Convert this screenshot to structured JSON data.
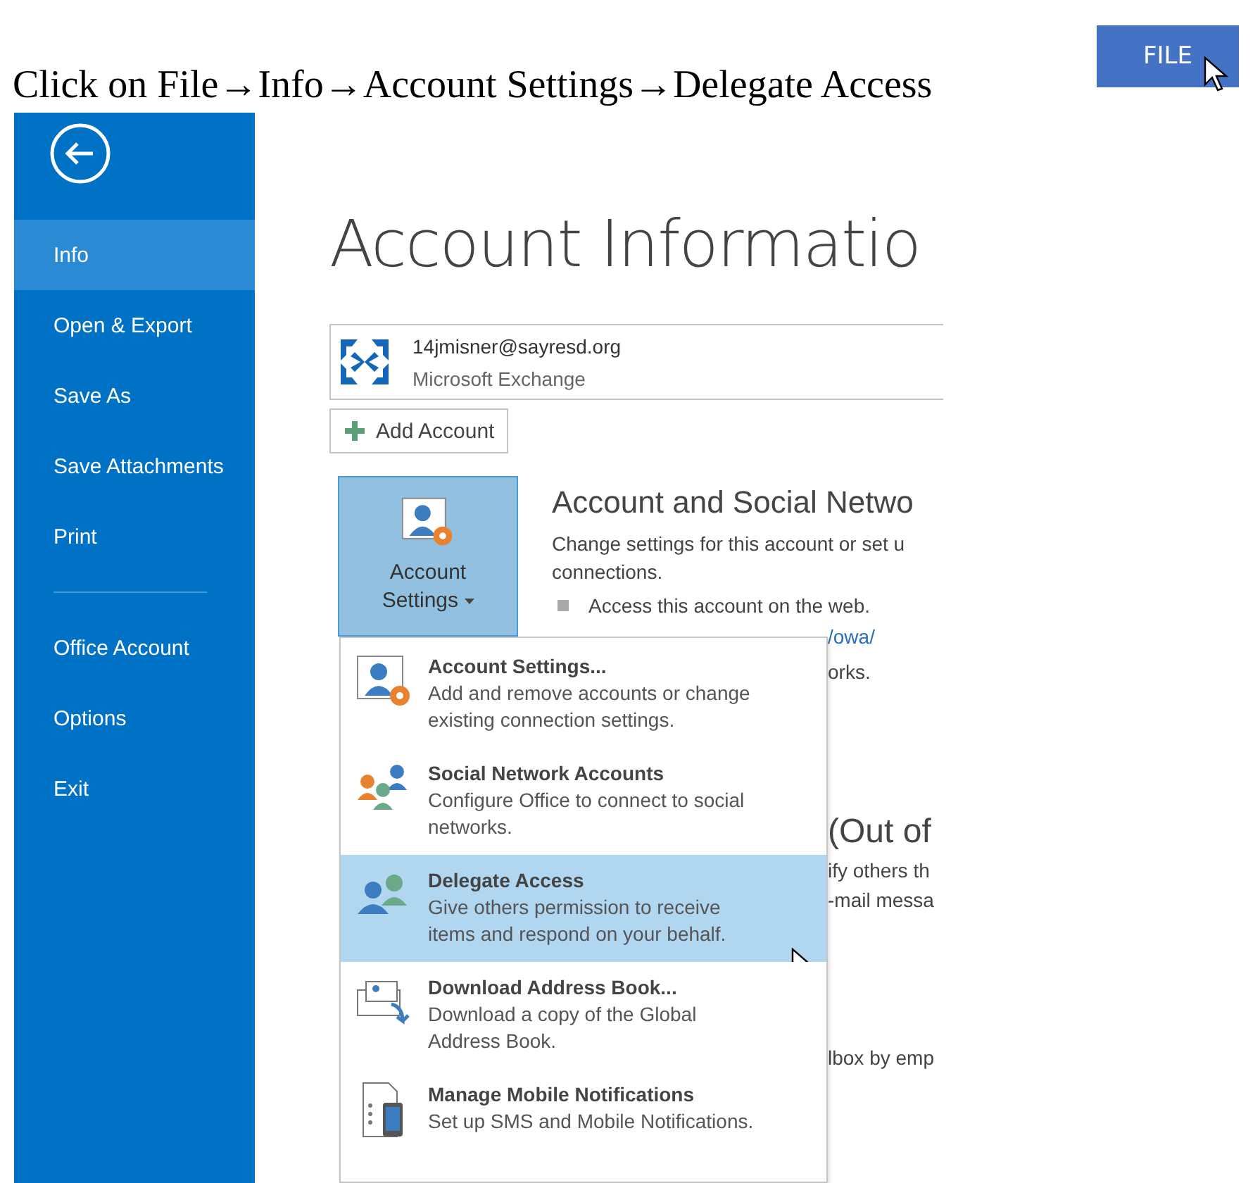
{
  "instruction": "Click on File→Info→Account Settings→Delegate Access",
  "file_button": {
    "label": "FILE"
  },
  "sidebar": {
    "items": [
      {
        "label": "Info",
        "selected": true
      },
      {
        "label": "Open & Export",
        "selected": false
      },
      {
        "label": "Save As",
        "selected": false
      },
      {
        "label": "Save Attachments",
        "selected": false
      },
      {
        "label": "Print",
        "selected": false
      }
    ],
    "lower_items": [
      {
        "label": "Office Account",
        "selected": false
      },
      {
        "label": "Options",
        "selected": false
      },
      {
        "label": "Exit",
        "selected": false
      }
    ]
  },
  "title": "Account Informatio",
  "account": {
    "email": "14jmisner@sayresd.org",
    "type": "Microsoft Exchange"
  },
  "add_account": {
    "label": "Add Account"
  },
  "account_settings_button": {
    "line1": "Account",
    "line2": "Settings",
    "expanded": true
  },
  "section": {
    "heading": "Account and Social Netwo",
    "description": "Change settings for this account or set u",
    "description_2": "connections.",
    "bullet": "Access this account on the web."
  },
  "hidden_fragments": [
    {
      "kind": "link",
      "text": "/owa/"
    },
    {
      "kind": "text",
      "text": "orks."
    },
    {
      "kind": "heading",
      "text": "(Out of"
    },
    {
      "kind": "text",
      "text": "ify others th"
    },
    {
      "kind": "text",
      "text": "-mail messa"
    },
    {
      "kind": "gap"
    },
    {
      "kind": "text",
      "text": "lbox by emp"
    }
  ],
  "menu": {
    "items": [
      {
        "title": "Account Settings...",
        "description": "Add and remove accounts or change existing connection settings.",
        "selected": false
      },
      {
        "title": "Social Network Accounts",
        "description": "Configure Office to connect to social networks.",
        "selected": false
      },
      {
        "title": "Delegate Access",
        "description": "Give others permission to receive items and respond on your behalf.",
        "selected": true
      },
      {
        "title": "Download Address Book...",
        "description": "Download a copy of the Global Address Book.",
        "selected": false
      },
      {
        "title": "Manage Mobile Notifications",
        "description": "Set up SMS and Mobile Notifications.",
        "selected": false
      }
    ]
  }
}
